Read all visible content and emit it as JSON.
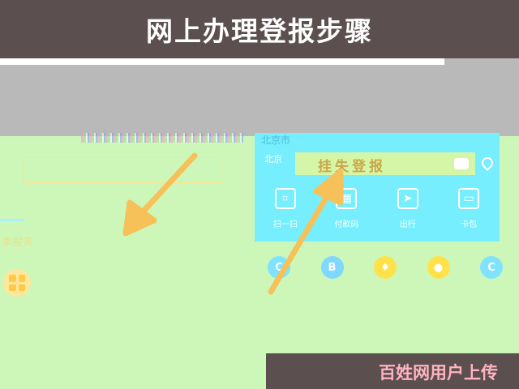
{
  "title": "网上办理登报步骤",
  "left_panel": {
    "label": "本服务"
  },
  "blue_panel": {
    "top_text": "北京市",
    "city_label": "北京\n·\n·",
    "search_text": "挂失登报",
    "actions": [
      {
        "icon": "scan-icon",
        "label": "扫一扫"
      },
      {
        "icon": "card-icon",
        "label": "付款码"
      },
      {
        "icon": "location-icon",
        "label": "出行"
      },
      {
        "icon": "wallet-icon",
        "label": "卡包"
      }
    ]
  },
  "service_icons": [
    {
      "name": "service-icon-1",
      "glyph": "C",
      "color": "#7fe3ff"
    },
    {
      "name": "service-icon-2",
      "glyph": "B",
      "color": "#7fd8ff"
    },
    {
      "name": "service-icon-3",
      "glyph": "♦",
      "color": "#ffe24a"
    },
    {
      "name": "service-icon-4",
      "glyph": "●",
      "color": "#ffe24a"
    },
    {
      "name": "service-icon-5",
      "glyph": "C",
      "color": "#7fe3ff"
    }
  ],
  "watermark": "百姓网用户上传",
  "colors": {
    "title_bg": "#5c4f4f",
    "background": "#cdf7b9",
    "panel": "#76eefe",
    "arrow": "#f7c15a"
  }
}
